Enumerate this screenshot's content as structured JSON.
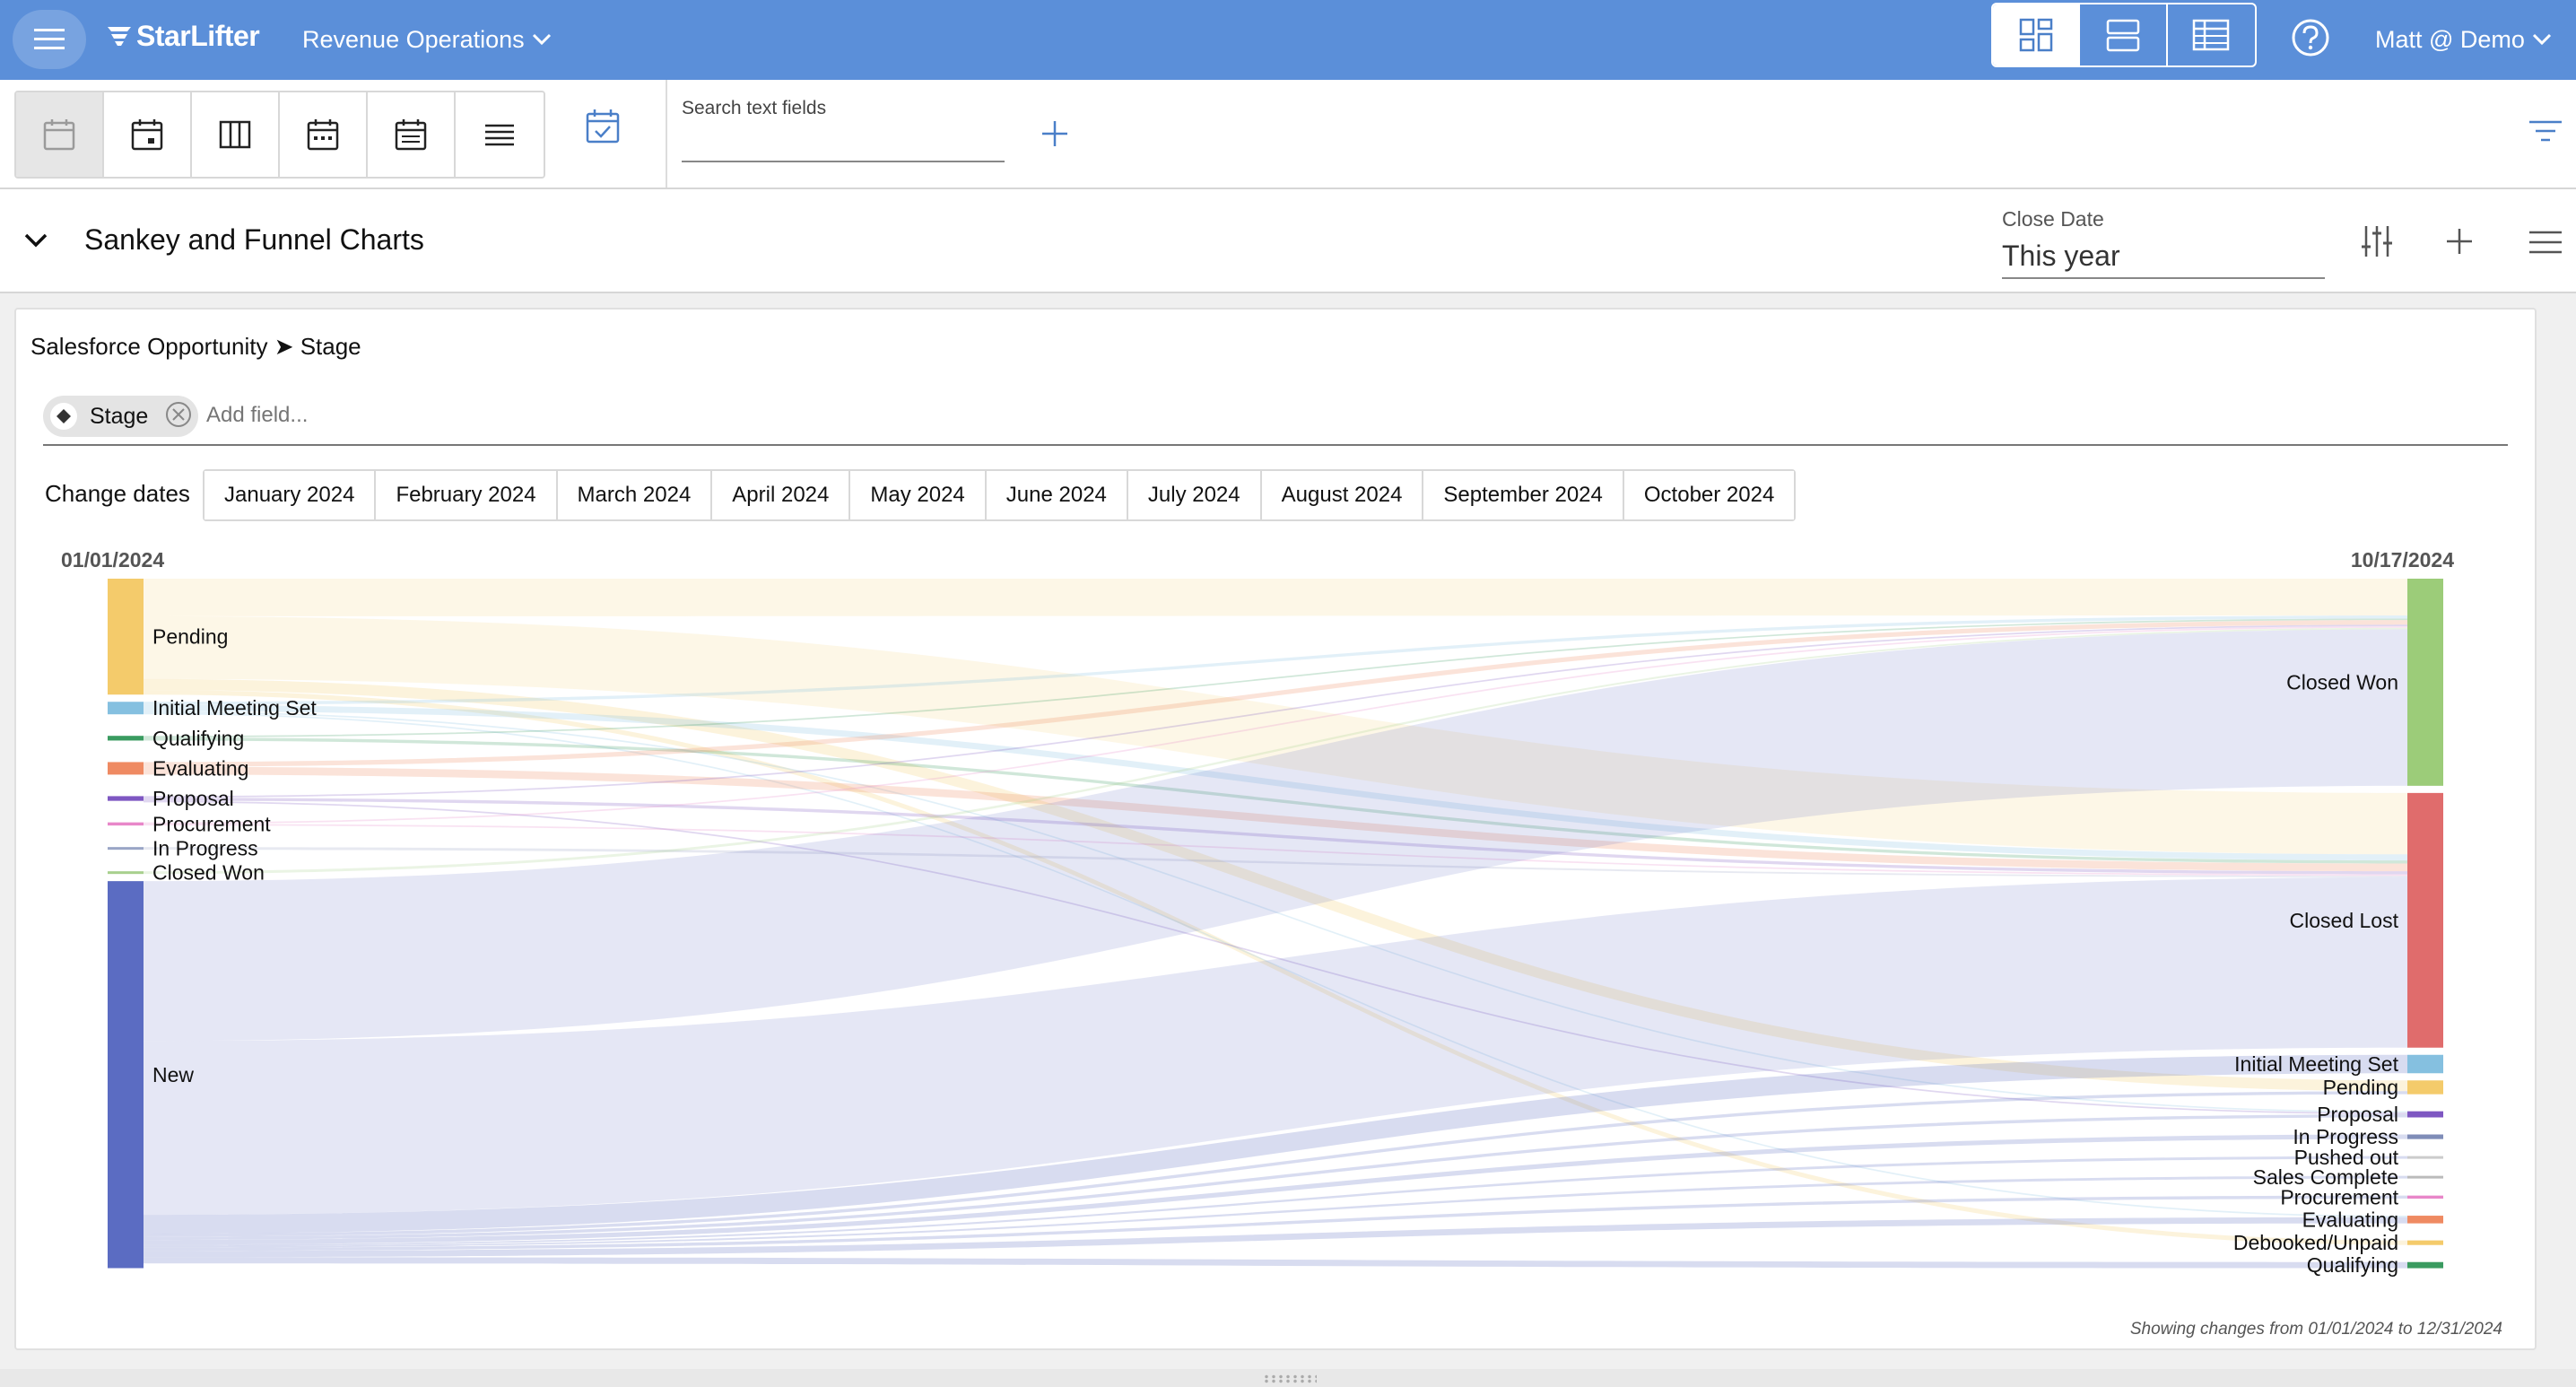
{
  "app": {
    "logo_text": "StarLifter",
    "workspace": "Revenue Operations",
    "user": "Matt @ Demo",
    "accent_color": "#5b8fd9"
  },
  "toolbar": {
    "view_buttons": [
      "grid-view-icon",
      "rows-view-icon",
      "table-view-icon"
    ],
    "calendar_buttons": [
      "calendar-blank-icon",
      "calendar-day-icon",
      "calendar-columns-icon",
      "calendar-week-icon",
      "calendar-list-icon",
      "lines-icon"
    ],
    "search_label": "Search text fields",
    "search_value": ""
  },
  "section": {
    "title": "Sankey and Funnel Charts",
    "close_date_label": "Close Date",
    "close_date_value": "This year"
  },
  "panel": {
    "breadcrumb": "Salesforce Opportunity ➤ Stage",
    "chip_label": "Stage",
    "add_field_placeholder": "Add field...",
    "change_dates_label": "Change dates",
    "months": [
      "January 2024",
      "February 2024",
      "March 2024",
      "April 2024",
      "May 2024",
      "June 2024",
      "July 2024",
      "August 2024",
      "September 2024",
      "October 2024"
    ],
    "footnote": "Showing changes from 01/01/2024 to 12/31/2024"
  },
  "chart_data": {
    "type": "sankey",
    "start_date": "01/01/2024",
    "end_date": "10/17/2024",
    "source_nodes": [
      {
        "name": "Pending",
        "value": 74,
        "color": "#f4cb6b"
      },
      {
        "name": "Initial Meeting Set",
        "value": 8,
        "color": "#85c0e0"
      },
      {
        "name": "Qualifying",
        "value": 3,
        "color": "#3a9b60"
      },
      {
        "name": "Evaluating",
        "value": 8,
        "color": "#ef8a62"
      },
      {
        "name": "Proposal",
        "value": 3,
        "color": "#7e57c2"
      },
      {
        "name": "Procurement",
        "value": 2,
        "color": "#e887c9"
      },
      {
        "name": "In Progress",
        "value": 1,
        "color": "#9aa5c6"
      },
      {
        "name": "Closed Won",
        "value": 1,
        "color": "#a8d08d"
      },
      {
        "name": "New",
        "value": 247,
        "color": "#5b6cc2"
      }
    ],
    "target_nodes": [
      {
        "name": "Closed Won",
        "value": 135,
        "color": "#9ccc79"
      },
      {
        "name": "Closed Lost",
        "value": 166,
        "color": "#e06c6c"
      },
      {
        "name": "Initial Meeting Set",
        "value": 12,
        "color": "#85c0e0"
      },
      {
        "name": "Pending",
        "value": 9,
        "color": "#f4cb6b"
      },
      {
        "name": "Proposal",
        "value": 4,
        "color": "#7e57c2"
      },
      {
        "name": "In Progress",
        "value": 3,
        "color": "#7f8db8"
      },
      {
        "name": "Pushed out",
        "value": 1,
        "color": "#cccccc"
      },
      {
        "name": "Sales Complete",
        "value": 1,
        "color": "#bbbbbb"
      },
      {
        "name": "Procurement",
        "value": 2,
        "color": "#e887c9"
      },
      {
        "name": "Evaluating",
        "value": 5,
        "color": "#ef8a62"
      },
      {
        "name": "Debooked/Unpaid",
        "value": 3,
        "color": "#f4cb6b"
      },
      {
        "name": "Qualifying",
        "value": 4,
        "color": "#3a9b60"
      }
    ],
    "links": [
      {
        "source": "Pending",
        "target": "Closed Won",
        "value": 24
      },
      {
        "source": "Pending",
        "target": "Closed Lost",
        "value": 40
      },
      {
        "source": "Pending",
        "target": "Pending",
        "value": 7
      },
      {
        "source": "Pending",
        "target": "Debooked/Unpaid",
        "value": 3
      },
      {
        "source": "Initial Meeting Set",
        "target": "Closed Won",
        "value": 2
      },
      {
        "source": "Initial Meeting Set",
        "target": "Closed Lost",
        "value": 4
      },
      {
        "source": "Initial Meeting Set",
        "target": "Proposal",
        "value": 1
      },
      {
        "source": "Initial Meeting Set",
        "target": "Evaluating",
        "value": 1
      },
      {
        "source": "Qualifying",
        "target": "Closed Won",
        "value": 1
      },
      {
        "source": "Qualifying",
        "target": "Closed Lost",
        "value": 2
      },
      {
        "source": "Evaluating",
        "target": "Closed Won",
        "value": 3
      },
      {
        "source": "Evaluating",
        "target": "Closed Lost",
        "value": 5
      },
      {
        "source": "Proposal",
        "target": "Closed Won",
        "value": 1
      },
      {
        "source": "Proposal",
        "target": "Closed Lost",
        "value": 2
      },
      {
        "source": "Procurement",
        "target": "Closed Won",
        "value": 1
      },
      {
        "source": "Procurement",
        "target": "Closed Lost",
        "value": 1
      },
      {
        "source": "In Progress",
        "target": "Closed Lost",
        "value": 1
      },
      {
        "source": "Closed Won",
        "target": "Closed Won",
        "value": 1
      },
      {
        "source": "New",
        "target": "Closed Won",
        "value": 102
      },
      {
        "source": "New",
        "target": "Closed Lost",
        "value": 111
      },
      {
        "source": "New",
        "target": "Initial Meeting Set",
        "value": 12
      },
      {
        "source": "New",
        "target": "Pending",
        "value": 2
      },
      {
        "source": "New",
        "target": "Proposal",
        "value": 2
      },
      {
        "source": "New",
        "target": "In Progress",
        "value": 3
      },
      {
        "source": "New",
        "target": "Pushed out",
        "value": 1
      },
      {
        "source": "New",
        "target": "Sales Complete",
        "value": 1
      },
      {
        "source": "New",
        "target": "Procurement",
        "value": 2
      },
      {
        "source": "New",
        "target": "Evaluating",
        "value": 4
      },
      {
        "source": "New",
        "target": "Qualifying",
        "value": 4
      },
      {
        "source": "Proposal",
        "target": "Proposal",
        "value": 1
      }
    ]
  }
}
